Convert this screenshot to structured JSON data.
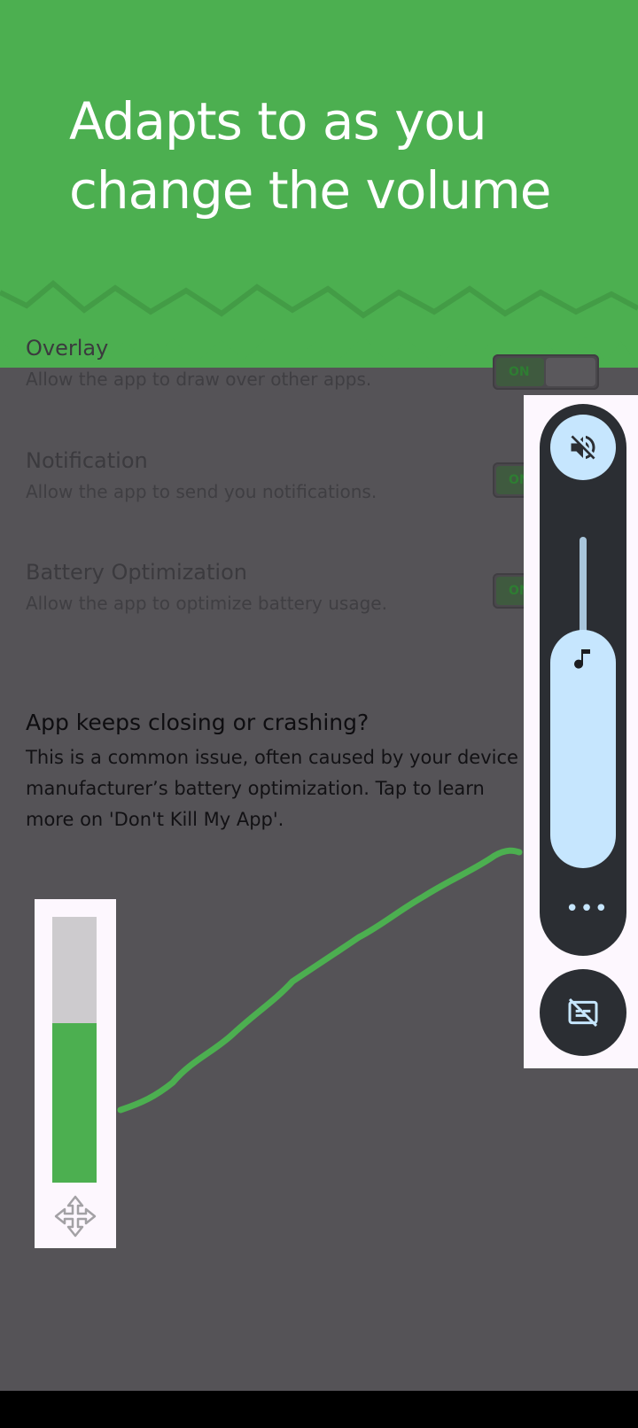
{
  "header": {
    "title": "Adapts to as you change the volume"
  },
  "settings": [
    {
      "title": "Overlay",
      "description": "Allow the app to draw over other apps.",
      "toggle_label": "ON"
    },
    {
      "title": "Notification",
      "description": "Allow the app to send you notifications.",
      "toggle_label": "ON"
    },
    {
      "title": "Battery Optimization",
      "description": "Allow the app to optimize battery usage.",
      "toggle_label": "ON"
    }
  ],
  "help": {
    "title": "App keeps closing or crashing?",
    "body": "This is a common issue, often caused by your device manufacturer’s battery optimization. Tap to learn more on 'Don't Kill My App'."
  },
  "overlay_preview": {
    "level_fraction": 0.6,
    "fill_color": "#4caf50",
    "move_icon": "move-icon"
  },
  "volume_panel": {
    "mute_icon": "volume-off-icon",
    "level_fraction": 0.72,
    "stream_icon": "music-note-icon",
    "more_label": "•••",
    "caption_icon": "closed-caption-off-icon",
    "accent": "#c6e6fe",
    "surface": "#2b2e33"
  }
}
